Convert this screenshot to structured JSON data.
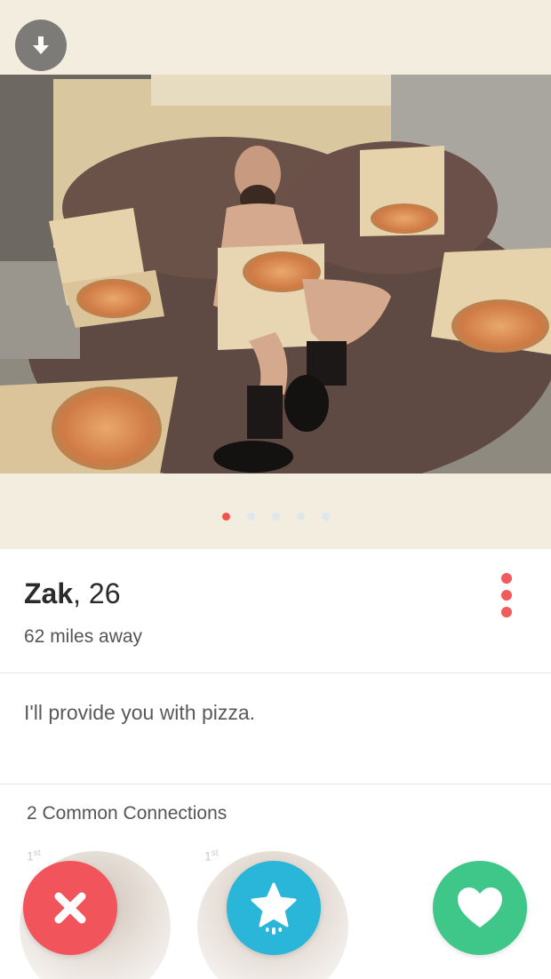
{
  "profile": {
    "name": "Zak",
    "age": "26",
    "distance": "62 miles away",
    "bio": "I'll provide you with pizza."
  },
  "photos": {
    "count": 5,
    "active_index": 0
  },
  "connections": {
    "title": "2 Common Connections",
    "items": [
      {
        "degree": "1",
        "suffix": "st"
      },
      {
        "degree": "1",
        "suffix": "st"
      }
    ]
  },
  "colors": {
    "nope": "#f2545b",
    "super_like": "#29b6d8",
    "like": "#3fc789",
    "accent": "#f05b5b",
    "background": "#f3ede0"
  },
  "icons": {
    "collapse": "arrow-down-icon",
    "more": "more-vertical-icon",
    "nope": "close-icon",
    "super_like": "star-icon",
    "like": "heart-icon"
  }
}
